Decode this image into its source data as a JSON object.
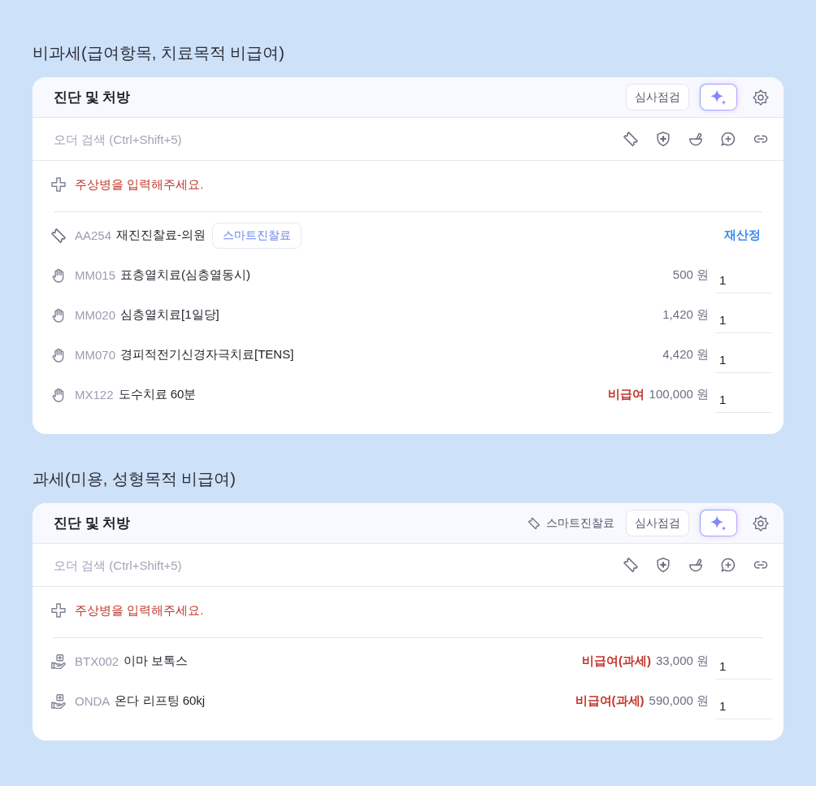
{
  "sections": [
    {
      "title": "비과세(급여항목, 치료목적 비급여)",
      "panel": {
        "title": "진단 및 처방",
        "review_button": "심사점검",
        "search": {
          "placeholder": "오더 검색 (Ctrl+Shift+5)"
        },
        "diagnosis_prompt": "주상병을 입력해주세요.",
        "orders": [
          {
            "kind": "consultation",
            "code": "AA254",
            "name": "재진진찰료-의원",
            "tag": "스마트진찰료",
            "action": "재산정"
          },
          {
            "kind": "therapy",
            "code": "MM015",
            "name": "표층열치료(심층열동시)",
            "price": "500 원",
            "quantity": "1"
          },
          {
            "kind": "therapy",
            "code": "MM020",
            "name": "심층열치료[1일당]",
            "price": "1,420 원",
            "quantity": "1"
          },
          {
            "kind": "therapy",
            "code": "MM070",
            "name": "경피적전기신경자극치료[TENS]",
            "price": "4,420 원",
            "quantity": "1"
          },
          {
            "kind": "therapy",
            "code": "MX122",
            "name": "도수치료 60분",
            "coverage": "비급여",
            "price": "100,000 원",
            "quantity": "1"
          }
        ]
      }
    },
    {
      "title": "과세(미용, 성형목적 비급여)",
      "panel": {
        "title": "진단 및 처방",
        "smart_link": "스마트진찰료",
        "review_button": "심사점검",
        "search": {
          "placeholder": "오더 검색 (Ctrl+Shift+5)"
        },
        "diagnosis_prompt": "주상병을 입력해주세요.",
        "orders": [
          {
            "kind": "procedure",
            "code": "BTX002",
            "name": "이마 보톡스",
            "coverage": "비급여(과세)",
            "price": "33,000 원",
            "quantity": "1"
          },
          {
            "kind": "procedure",
            "code": "ONDA",
            "name": "온다 리프팅 60kj",
            "coverage": "비급여(과세)",
            "price": "590,000 원",
            "quantity": "1"
          }
        ]
      }
    }
  ]
}
